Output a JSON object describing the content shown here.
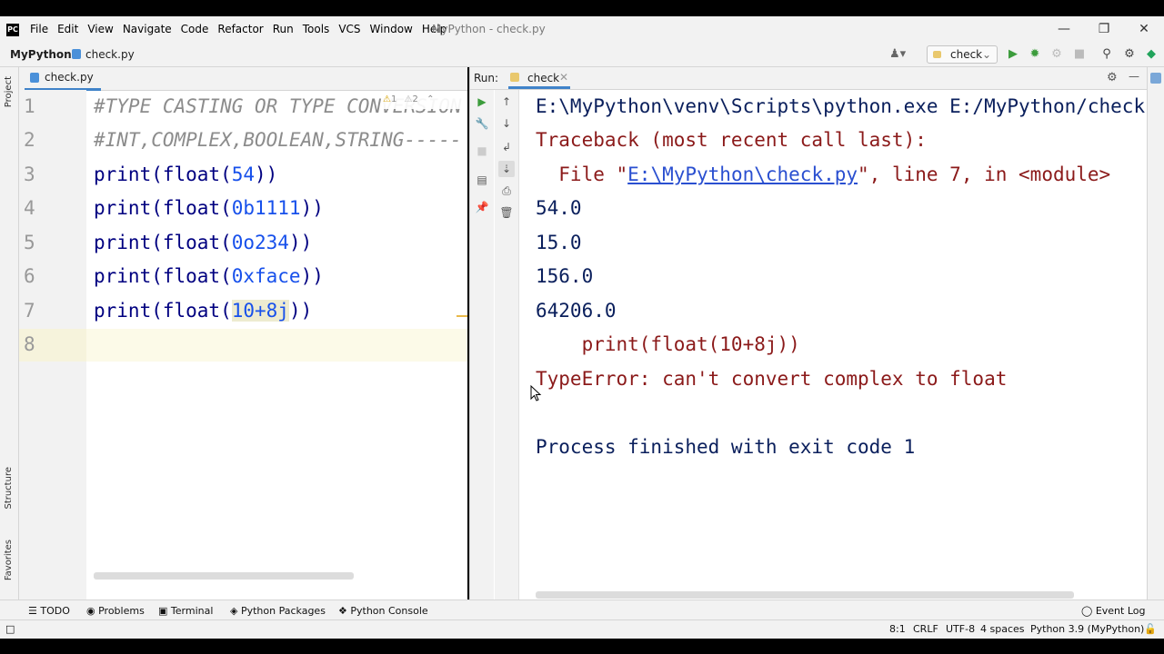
{
  "menubar": {
    "logo": "PC",
    "items": [
      "File",
      "Edit",
      "View",
      "Navigate",
      "Code",
      "Refactor",
      "Run",
      "Tools",
      "VCS",
      "Window",
      "Help"
    ],
    "window_title": "MyPython - check.py"
  },
  "navbar": {
    "project": "MyPython",
    "file": "check.py",
    "run_config": "check"
  },
  "left_strip": {
    "project": "Project",
    "structure": "Structure",
    "favorites": "Favorites"
  },
  "editor": {
    "tab": "check.py",
    "warnings": "1",
    "weak_warnings": "2",
    "lines": [
      {
        "n": "1",
        "text": "#TYPE CASTING OR TYPE CONVERSION"
      },
      {
        "n": "2",
        "text": "#INT,COMPLEX,BOOLEAN,STRING-----"
      },
      {
        "n": "3",
        "pre": "print(float(",
        "num": "54",
        "post": "))"
      },
      {
        "n": "4",
        "pre": "print(float(",
        "num": "0b1111",
        "post": "))"
      },
      {
        "n": "5",
        "pre": "print(float(",
        "num": "0o234",
        "post": "))"
      },
      {
        "n": "6",
        "pre": "print(float(",
        "num": "0xface",
        "post": "))"
      },
      {
        "n": "7",
        "pre": "print(float(",
        "num": "10+8j",
        "post": "))"
      },
      {
        "n": "8",
        "text": ""
      }
    ]
  },
  "run": {
    "label": "Run:",
    "tab": "check",
    "output": {
      "cmd": "E:\\MyPython\\venv\\Scripts\\python.exe E:/MyPython/check.py",
      "traceback": "Traceback (most recent call last):",
      "file_pre": "  File \"",
      "file_link": "E:\\MyPython\\check.py",
      "file_post": "\", line 7, in <module>",
      "o1": "54.0",
      "o2": "15.0",
      "o3": "156.0",
      "o4": "64206.0",
      "code_line": "    print(float(10+8j))",
      "error": "TypeError: can't convert complex to float",
      "finished": "Process finished with exit code 1"
    }
  },
  "toolwindows": {
    "todo": "TODO",
    "problems": "Problems",
    "terminal": "Terminal",
    "packages": "Python Packages",
    "console": "Python Console",
    "eventlog": "Event Log"
  },
  "status": {
    "position": "8:1",
    "line_sep": "CRLF",
    "encoding": "UTF-8",
    "indent": "4 spaces",
    "interpreter": "Python 3.9 (MyPython)"
  }
}
